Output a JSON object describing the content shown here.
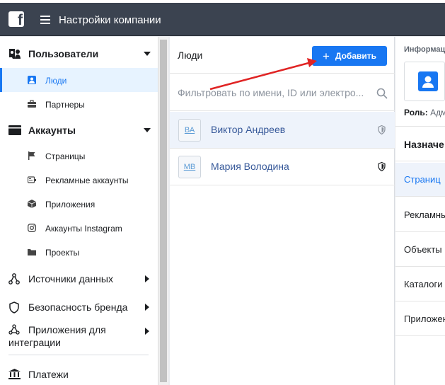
{
  "topbar": {
    "title": "Настройки компании",
    "logo_letter": "f"
  },
  "sidebar": {
    "sections": [
      {
        "label": "Пользователи",
        "icon": "users-icon"
      },
      {
        "label": "Аккаунты",
        "icon": "folder-icon"
      }
    ],
    "users_items": [
      {
        "label": "Люди",
        "icon": "person-icon",
        "active": true
      },
      {
        "label": "Партнеры",
        "icon": "briefcase-icon"
      }
    ],
    "accounts_items": [
      {
        "label": "Страницы",
        "icon": "flag-icon"
      },
      {
        "label": "Рекламные аккаунты",
        "icon": "ad-account-icon"
      },
      {
        "label": "Приложения",
        "icon": "cube-icon"
      },
      {
        "label": "Аккаунты Instagram",
        "icon": "instagram-icon"
      },
      {
        "label": "Проекты",
        "icon": "project-folder-icon"
      }
    ],
    "more": [
      {
        "label": "Источники данных",
        "icon": "data-sources-icon"
      },
      {
        "label": "Безопасность бренда",
        "icon": "shield-icon"
      },
      {
        "label_line1": "Приложения для",
        "label_line2": "интеграции",
        "icon": "integrations-icon"
      }
    ],
    "payments": {
      "label": "Платежи",
      "icon": "bank-icon"
    }
  },
  "people_panel": {
    "title": "Люди",
    "add_button": "Добавить",
    "filter_placeholder": "Фильтровать по имени, ID или электро...",
    "people": [
      {
        "initials": "ВА",
        "name": "Виктор Андреев"
      },
      {
        "initials": "МВ",
        "name": "Мария Володина"
      }
    ]
  },
  "detail_panel": {
    "info_label": "Информац",
    "role_label": "Роль:",
    "role_value": "Адм",
    "assigned_header": "Назначе",
    "items": [
      "Страниц",
      "Рекламны",
      "Объекты",
      "Каталоги",
      "Приложен"
    ]
  },
  "colors": {
    "accent": "#1877f2",
    "topbar": "#3b4350",
    "annotation_arrow": "#e02424"
  }
}
